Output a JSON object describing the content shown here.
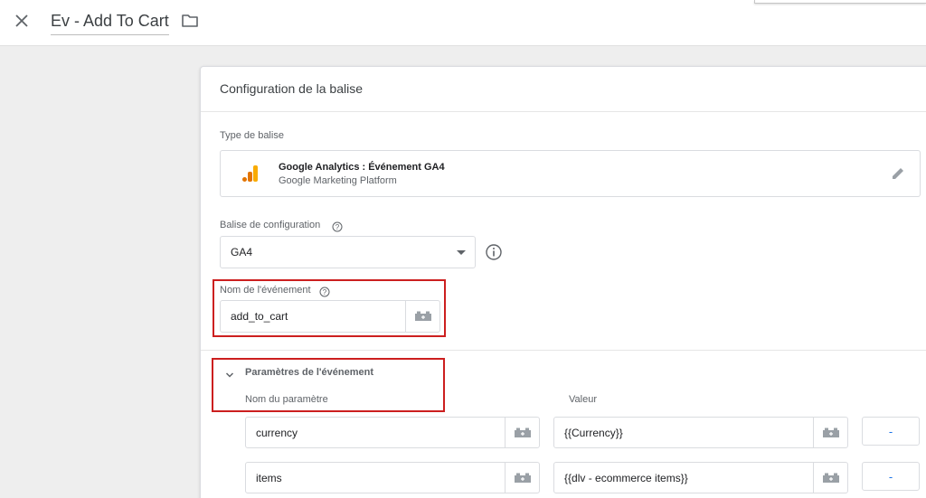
{
  "header": {
    "title": "Ev - Add To Cart",
    "close_icon": "close-icon",
    "folder_icon": "folder-icon"
  },
  "card": {
    "title": "Configuration de la balise",
    "tag_type_label": "Type de balise",
    "tag_type": {
      "name": "Google Analytics : Événement GA4",
      "provider": "Google Marketing Platform",
      "icon": "google-analytics-icon",
      "edit_icon": "pencil-icon"
    },
    "config_tag": {
      "label": "Balise de configuration",
      "value": "GA4"
    },
    "event_name": {
      "label": "Nom de l'événement",
      "value": "add_to_cart"
    },
    "event_params": {
      "title": "Paramètres de l'événement",
      "col_name": "Nom du paramètre",
      "col_value": "Valeur",
      "rows": [
        {
          "name": "currency",
          "value": "{{Currency}}",
          "remove_label": "-"
        },
        {
          "name": "items",
          "value": "{{dlv - ecommerce items}}",
          "remove_label": "-"
        }
      ]
    }
  },
  "colors": {
    "accent": "#1a73e8",
    "highlight_border": "#cc1f1f",
    "ga_orange": "#f9ab00",
    "ga_dark_orange": "#e37400"
  }
}
